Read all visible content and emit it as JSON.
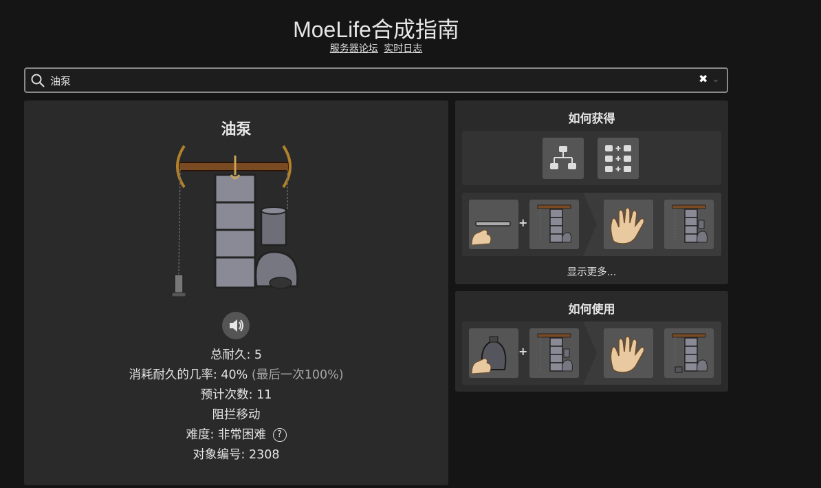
{
  "header": {
    "title": "MoeLife合成指南",
    "links": [
      "服务器论坛",
      "实时日志"
    ]
  },
  "search": {
    "value": "油泵",
    "icon": "search-icon",
    "clear_glyph": "✖",
    "dropdown_glyph": "⌄"
  },
  "object": {
    "name": "油泵",
    "total_durability": "总耐久: 5",
    "wear_chance_label": "消耗耐久的几率: 40%",
    "wear_chance_last": "(最后一次100%)",
    "estimated_uses": "预计次数: 11",
    "blocks_movement": "阻拦移动",
    "difficulty": "难度: 非常困难",
    "difficulty_help": "?",
    "object_id": "对象编号: 2308"
  },
  "obtain": {
    "title": "如何获得",
    "view_buttons": [
      "tree-view-icon",
      "grid-view-icon"
    ],
    "show_more": "显示更多...",
    "plus": "+"
  },
  "use": {
    "title": "如何使用",
    "plus": "+"
  },
  "colors": {
    "background": "#151515",
    "panel": "#2a2a2a",
    "slot": "#555555",
    "skin": "#e8c9a0"
  }
}
